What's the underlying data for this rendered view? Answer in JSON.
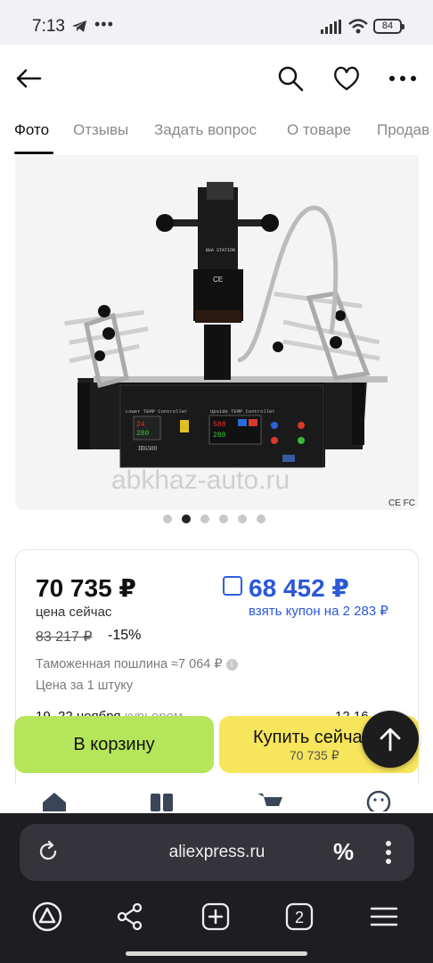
{
  "status_bar": {
    "time": "7:13",
    "battery": "84"
  },
  "header": {
    "back_icon": "arrow-left-icon",
    "search_icon": "search-icon",
    "favorite_icon": "heart-icon",
    "menu_icon": "more-horizontal-icon"
  },
  "tabs": [
    {
      "label": "Фото",
      "active": true
    },
    {
      "label": "Отзывы"
    },
    {
      "label": "Задать вопрос"
    },
    {
      "label": "О товаре"
    },
    {
      "label": "Продав"
    }
  ],
  "gallery": {
    "product_label": "IR6500",
    "device_panel_left": "Lower TEMP Controller",
    "device_panel_right": "Upside TEMP Controller",
    "watermark": "abkhaz-auto.ru",
    "cert_marks": "CE FC",
    "image_count": 6,
    "active_index": 1
  },
  "price": {
    "current": "70 735 ₽",
    "current_label": "цена сейчас",
    "old": "83 217 ₽",
    "discount": "-15%",
    "coupon_price": "68 452 ₽",
    "coupon_label": "взять купон на 2 283 ₽",
    "duty": "Таможенная пошлина ≈7 064 ₽",
    "unit": "Цена за 1 штуку",
    "delivery_dates": "19–22 ноября",
    "delivery_carrier": "курьером",
    "delivery_price": "12 16"
  },
  "actions": {
    "cart_label": "В корзину",
    "buy_label": "Купить сейчас",
    "buy_price": "70 735 ₽"
  },
  "browser": {
    "url": "aliexpress.ru",
    "percent_icon": "%",
    "tab_count": "2"
  },
  "colors": {
    "cart_green": "#b5e55a",
    "buy_yellow": "#f7e55c",
    "coupon_blue": "#2a58d8"
  }
}
